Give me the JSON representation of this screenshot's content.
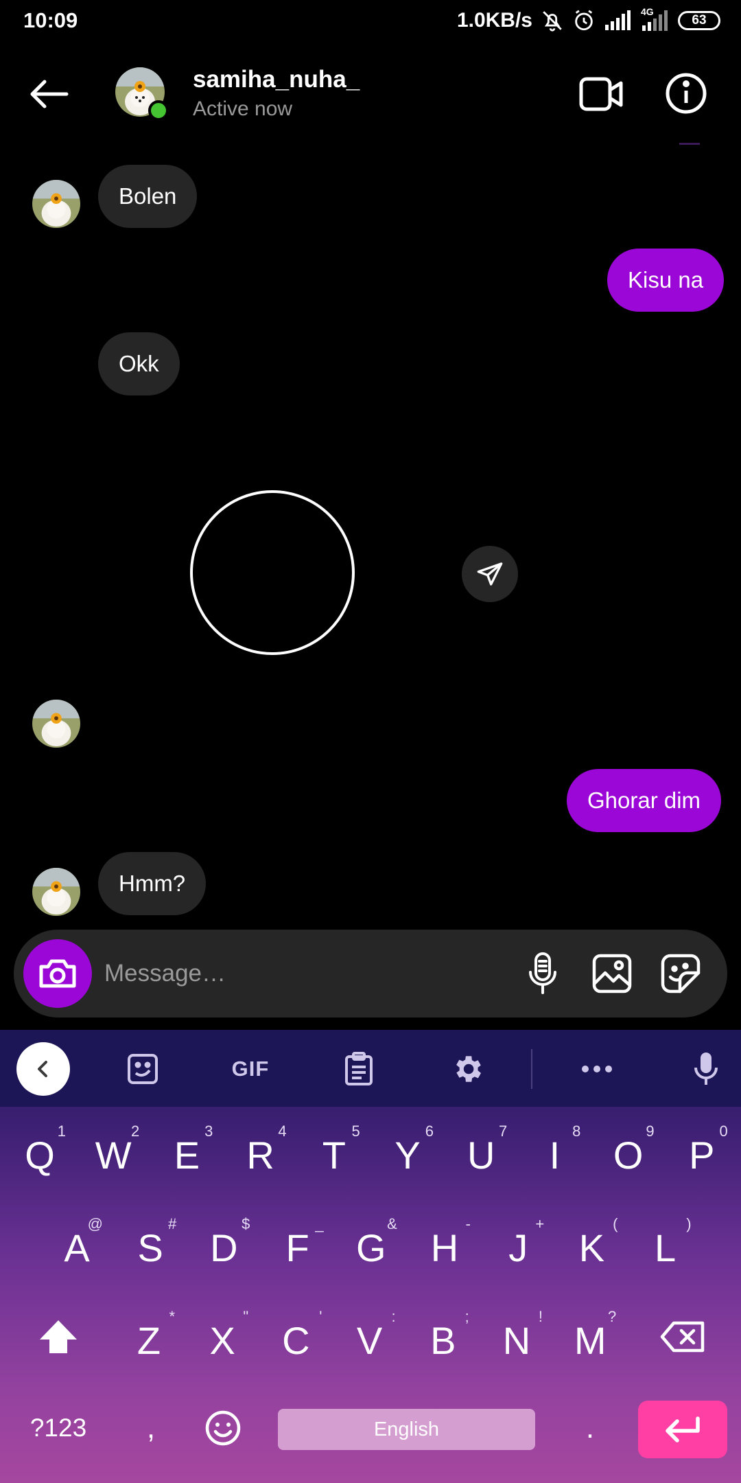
{
  "status_bar": {
    "time": "10:09",
    "net_speed": "1.0KB/s",
    "network": "4G",
    "battery": "63"
  },
  "header": {
    "username": "samiha_nuha_",
    "status": "Active now"
  },
  "messages": [
    {
      "from": "them",
      "text": "Bolen"
    },
    {
      "from": "me",
      "text": "Kisu na"
    },
    {
      "from": "them",
      "text": "Okk"
    },
    {
      "from": "me",
      "text": "Ghorar dim"
    },
    {
      "from": "them",
      "text": "Hmm?"
    }
  ],
  "composer": {
    "placeholder": "Message…"
  },
  "keyboard": {
    "gif_label": "GIF",
    "row1": [
      {
        "key": "Q",
        "hint": "1"
      },
      {
        "key": "W",
        "hint": "2"
      },
      {
        "key": "E",
        "hint": "3"
      },
      {
        "key": "R",
        "hint": "4"
      },
      {
        "key": "T",
        "hint": "5"
      },
      {
        "key": "Y",
        "hint": "6"
      },
      {
        "key": "U",
        "hint": "7"
      },
      {
        "key": "I",
        "hint": "8"
      },
      {
        "key": "O",
        "hint": "9"
      },
      {
        "key": "P",
        "hint": "0"
      }
    ],
    "row2": [
      {
        "key": "A",
        "hint": "@"
      },
      {
        "key": "S",
        "hint": "#"
      },
      {
        "key": "D",
        "hint": "$"
      },
      {
        "key": "F",
        "hint": "_"
      },
      {
        "key": "G",
        "hint": "&"
      },
      {
        "key": "H",
        "hint": "-"
      },
      {
        "key": "J",
        "hint": "+"
      },
      {
        "key": "K",
        "hint": "("
      },
      {
        "key": "L",
        "hint": ")"
      }
    ],
    "row3": [
      {
        "key": "Z",
        "hint": "*"
      },
      {
        "key": "X",
        "hint": "\""
      },
      {
        "key": "C",
        "hint": "'"
      },
      {
        "key": "V",
        "hint": ":"
      },
      {
        "key": "B",
        "hint": ";"
      },
      {
        "key": "N",
        "hint": "!"
      },
      {
        "key": "M",
        "hint": "?"
      }
    ],
    "symbols_label": "?123",
    "comma": ",",
    "space_label": "English",
    "period": "."
  },
  "colors": {
    "accent_purple": "#9b07d6",
    "incoming_bubble": "#262626",
    "online_green": "#44c531",
    "enter_pink": "#ff3fa4"
  }
}
